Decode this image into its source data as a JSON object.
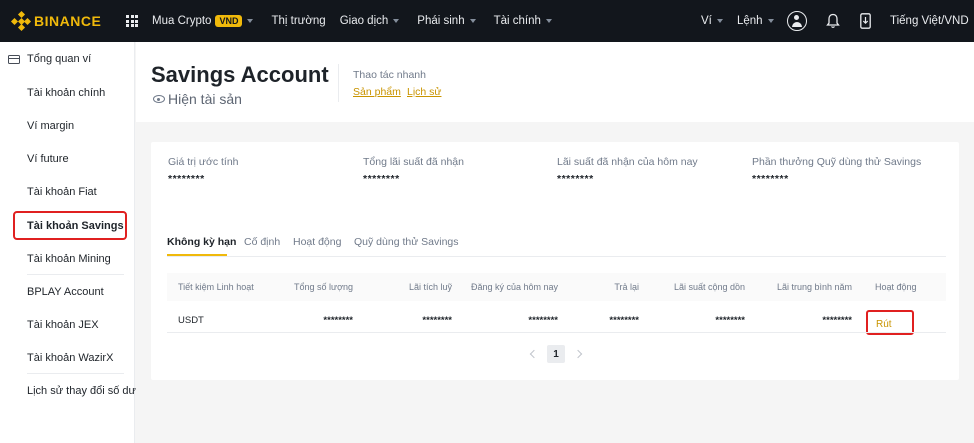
{
  "header": {
    "logo_text": "BINANCE",
    "nav": [
      {
        "label": "Mua Crypto",
        "badge": "VND",
        "has_caret": true
      },
      {
        "label": "Thị trường",
        "has_caret": false
      },
      {
        "label": "Giao dịch",
        "has_caret": true
      },
      {
        "label": "Phái sinh",
        "has_caret": true
      },
      {
        "label": "Tài chính",
        "has_caret": true
      }
    ],
    "right": {
      "wallet_label": "Ví",
      "orders_label": "Lệnh",
      "language_label": "Tiếng Việt/VND"
    },
    "colors": {
      "bar_bg": "#12161c",
      "brand": "#f0b90b"
    }
  },
  "sidebar": {
    "heading": "Tổng quan ví",
    "items": [
      {
        "label": "Tài khoản chính"
      },
      {
        "label": "Ví margin"
      },
      {
        "label": "Ví future"
      },
      {
        "label": "Tài khoản Fiat"
      },
      {
        "label": "Tài khoản Savings",
        "active": true
      },
      {
        "label": "Tài khoản Mining"
      },
      {
        "label": "BPLAY Account"
      },
      {
        "label": "Tài khoản JEX"
      },
      {
        "label": "Tài khoản WazirX"
      },
      {
        "label": "Lịch sử thay đổi số dư"
      }
    ]
  },
  "page": {
    "title": "Savings Account",
    "show_assets": "Hiện tài sản",
    "quick_actions": {
      "label": "Thao tác nhanh",
      "links": [
        "Sản phẩm",
        "Lịch sử"
      ]
    }
  },
  "summary": [
    {
      "label": "Giá trị ước tính",
      "value": "********"
    },
    {
      "label": "Tổng lãi suất đã nhận",
      "value": "********"
    },
    {
      "label": "Lãi suất đã nhận của hôm nay",
      "value": "********"
    },
    {
      "label": "Phần thưởng Quỹ dùng thử Savings",
      "value": "********"
    }
  ],
  "tabs": [
    {
      "label": "Không kỳ hạn",
      "active": true
    },
    {
      "label": "Cố định"
    },
    {
      "label": "Hoạt động"
    },
    {
      "label": "Quỹ dùng thử Savings"
    }
  ],
  "table": {
    "columns": [
      "Tiết kiệm Linh hoạt",
      "Tổng số lượng",
      "Lãi tích luỹ",
      "Đăng ký của hôm nay",
      "Trả lại",
      "Lãi suất cộng dồn",
      "Lãi trung bình năm",
      "Hoạt động"
    ],
    "rows": [
      {
        "asset": "USDT",
        "total": "********",
        "accrued": "********",
        "today_sub": "********",
        "returned": "********",
        "cumulative": "********",
        "annual": "********",
        "action": "Rút"
      }
    ]
  },
  "pagination": {
    "current": "1"
  }
}
